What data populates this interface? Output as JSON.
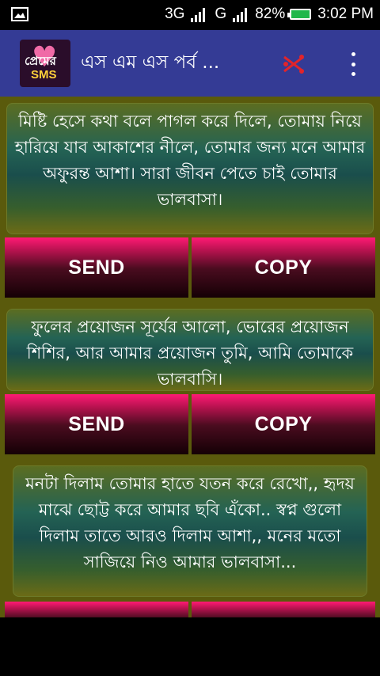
{
  "status_bar": {
    "network1": "3G",
    "network2": "G",
    "battery": "82%",
    "time": "3:02 PM"
  },
  "app_bar": {
    "logo_line1": "প্রেমের",
    "logo_line2": "SMS",
    "title": "এস এম এস পর্ব ..."
  },
  "messages": [
    {
      "text": "মিষ্টি হেসে কথা বলে পাগল করে দিলে, তোমায় নিয়ে হারিয়ে যাব আকাশের নীলে, তোমার জন্য মনে আমার অফুরন্ত আশা। সারা জীবন পেতে চাই তোমার ভালবাসা।"
    },
    {
      "text": "ফুলের প্রয়োজন সূর্যের আলো, ভোরের প্রয়োজন শিশির, আর আমার প্রয়োজন তুমি, আমি তোমাকে ভালবাসি।"
    },
    {
      "text": "মনটা দিলাম তোমার হাতে যতন করে রেখো,, হৃদয় মাঝে ছোট্ট করে আমার ছবি এঁকো.. স্বপ্ন গুলো দিলাম তাতে আরও দিলাম আশা,, মনের মতো সাজিয়ে নিও আমার ভালবাসা..."
    }
  ],
  "buttons": {
    "send": "SEND",
    "copy": "COPY"
  },
  "colors": {
    "app_bar": "#343b95",
    "content_bg": "#5a5a0c",
    "button_accent": "#ff1a74"
  }
}
